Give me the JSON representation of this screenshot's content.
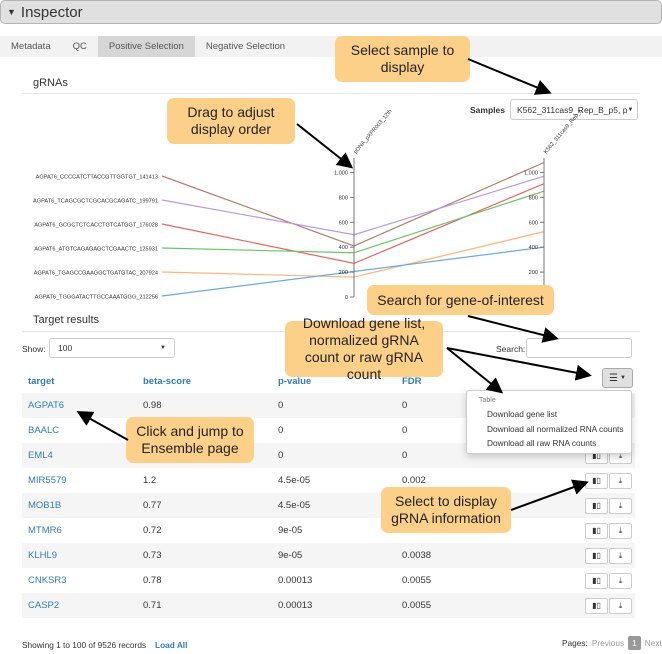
{
  "header": {
    "title": "Inspector"
  },
  "tabs": [
    {
      "label": "Metadata",
      "active": false
    },
    {
      "label": "QC",
      "active": false
    },
    {
      "label": "Positive Selection",
      "active": true
    },
    {
      "label": "Negative Selection",
      "active": false
    }
  ],
  "grnas": {
    "title": "gRNAs",
    "samples_label": "Samples",
    "samples_value": "K562_311cas9_Rep_B_p5, p"
  },
  "chart_data": {
    "type": "parallel-coordinates",
    "axes": [
      {
        "label": "pDNA_pXPR003_12th",
        "ticks": [
          "0",
          "200",
          "400",
          "600",
          "800",
          "1,000"
        ],
        "range": [
          0,
          1100
        ]
      },
      {
        "label": "K562_311cas9_Rep_B",
        "ticks": [
          "200",
          "400",
          "600",
          "800",
          "1,000"
        ],
        "range": [
          0,
          1100
        ]
      }
    ],
    "series": [
      {
        "name": "AGPAT6_CCCCATCTTACCGTTGGTGT_141413",
        "color": "#b07f6b",
        "values": [
          410,
          1080
        ]
      },
      {
        "name": "AGPAT6_TCAGCGCTCGCACGCAGATC_199791",
        "color": "#b79be0",
        "values": [
          500,
          970
        ]
      },
      {
        "name": "AGPAT6_GCGCTCTCACCTGTCATGGT_176028",
        "color": "#e06666",
        "values": [
          270,
          910
        ]
      },
      {
        "name": "AGPAT6_ATGTCAGAGAGCTCGAACTC_125931",
        "color": "#6ec26e",
        "values": [
          355,
          850
        ]
      },
      {
        "name": "AGPAT6_TGAGCCGAAGGCTGATGTAC_207924",
        "color": "#ffb27a",
        "values": [
          160,
          525
        ]
      },
      {
        "name": "AGPAT6_TGGGATACTTGCCAAATGGG_212256",
        "color": "#6fa8dc",
        "values": [
          205,
          400
        ]
      }
    ]
  },
  "results": {
    "title": "Target results",
    "show_label": "Show:",
    "show_value": "100",
    "search_label": "Search:",
    "search_value": "",
    "columns": [
      "target",
      "beta-score",
      "p-value",
      "FDR"
    ],
    "rows": [
      {
        "target": "AGPAT6",
        "beta": "0.98",
        "p": "0",
        "fdr": "0"
      },
      {
        "target": "BAALC",
        "beta": "",
        "p": "0",
        "fdr": "0"
      },
      {
        "target": "EML4",
        "beta": "",
        "p": "0",
        "fdr": "0"
      },
      {
        "target": "MIR5579",
        "beta": "1.2",
        "p": "4.5e-05",
        "fdr": "0.002"
      },
      {
        "target": "MOB1B",
        "beta": "0.77",
        "p": "4.5e-05",
        "fdr": ""
      },
      {
        "target": "MTMR6",
        "beta": "0.72",
        "p": "9e-05",
        "fdr": ""
      },
      {
        "target": "KLHL9",
        "beta": "0.73",
        "p": "9e-05",
        "fdr": "0.0038"
      },
      {
        "target": "CNKSR3",
        "beta": "0.78",
        "p": "0.00013",
        "fdr": "0.0055"
      },
      {
        "target": "CASP2",
        "beta": "0.71",
        "p": "0.00013",
        "fdr": "0.0055"
      }
    ],
    "menu": {
      "header": "Table",
      "items": [
        "Download gene list",
        "Download all normalized RNA counts",
        "Download all raw RNA counts"
      ]
    },
    "footer": {
      "info": "Showing 1 to 100 of 9526 records",
      "load_all": "Load All",
      "pages_label": "Pages:",
      "previous": "Previous",
      "current": "1",
      "next": "Next"
    }
  },
  "callouts": {
    "select_sample": "Select sample to display",
    "drag": "Drag to adjust display order",
    "search": "Search for gene-of-interest",
    "download": "Download gene list, normalized gRNA count or raw gRNA count",
    "click_jump": "Click and jump to Ensemble page",
    "select_grna": "Select to display gRNA information"
  },
  "colors": {
    "callout": "#fdd08a",
    "link": "#337ab7"
  }
}
